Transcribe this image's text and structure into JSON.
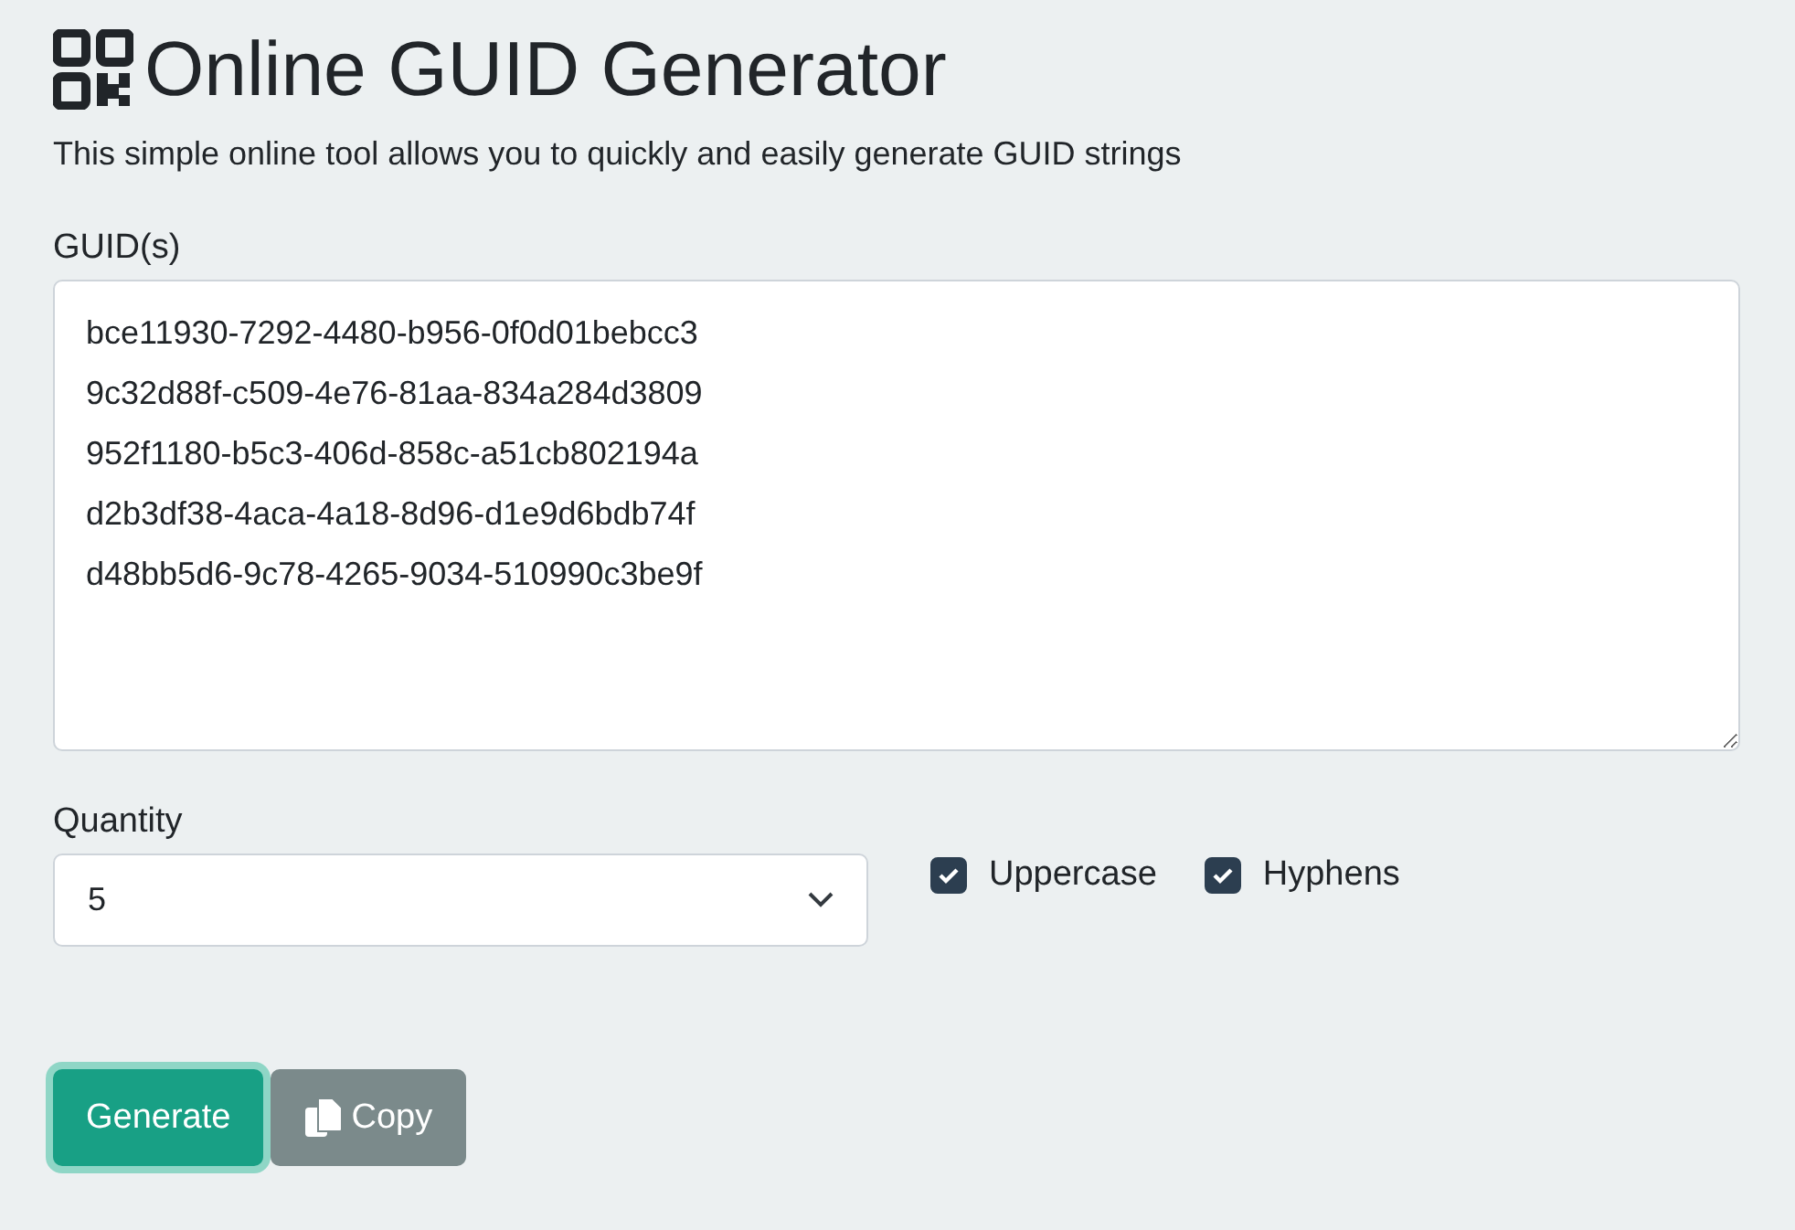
{
  "title": "Online GUID Generator",
  "description": "This simple online tool allows you to quickly and easily generate GUID strings",
  "guids": {
    "label": "GUID(s)",
    "value": "bce11930-7292-4480-b956-0f0d01bebcc3\n9c32d88f-c509-4e76-81aa-834a284d3809\n952f1180-b5c3-406d-858c-a51cb802194a\nd2b3df38-4aca-4a18-8d96-d1e9d6bdb74f\nd48bb5d6-9c78-4265-9034-510990c3be9f"
  },
  "quantity": {
    "label": "Quantity",
    "value": "5"
  },
  "options": [
    {
      "label": "Uppercase",
      "checked": true
    },
    {
      "label": "Hyphens",
      "checked": true
    }
  ],
  "buttons": [
    {
      "label": "Generate",
      "kind": "primary",
      "focused": true
    },
    {
      "label": "Copy",
      "kind": "copy",
      "focused": false
    }
  ]
}
